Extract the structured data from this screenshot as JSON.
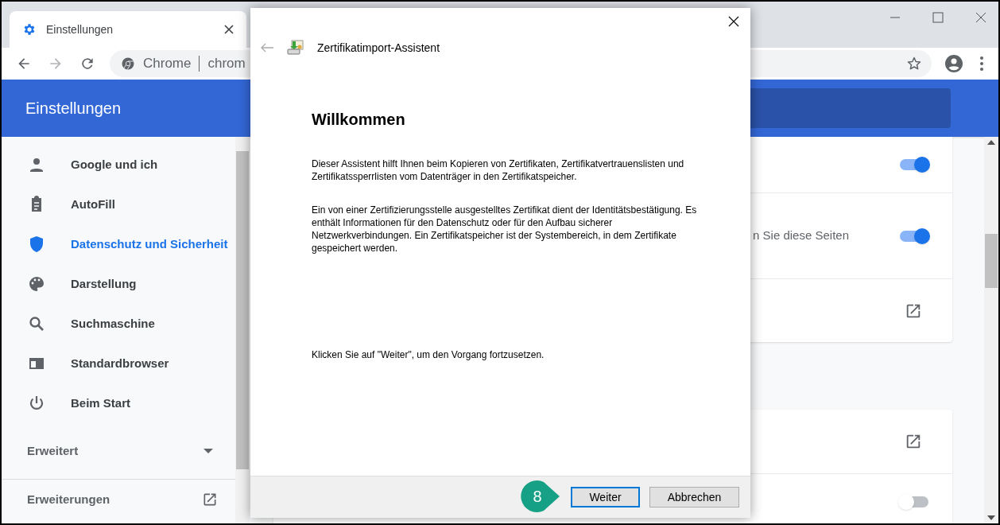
{
  "browser": {
    "tab": {
      "title": "Einstellungen"
    },
    "omnibox": {
      "site_label": "Chrome",
      "url": "chrom"
    },
    "header": {
      "title": "Einstellungen"
    },
    "sidebar": {
      "items": [
        {
          "label": "Google und ich",
          "selected": false
        },
        {
          "label": "AutoFill",
          "selected": false
        },
        {
          "label": "Datenschutz und Sicherheit",
          "selected": true
        },
        {
          "label": "Darstellung",
          "selected": false
        },
        {
          "label": "Suchmaschine",
          "selected": false
        },
        {
          "label": "Standardbrowser",
          "selected": false
        },
        {
          "label": "Beim Start",
          "selected": false
        }
      ],
      "advanced": {
        "label": "Erweitert",
        "expanded": false
      },
      "extensions": {
        "label": "Erweiterungen"
      }
    },
    "content": {
      "cards": [
        {
          "rows": [
            {
              "kind": "toggle",
              "on": true
            },
            {
              "kind": "toggle",
              "text": "n Sie diese Seiten",
              "on": true
            },
            {
              "kind": "link"
            }
          ]
        },
        {
          "rows": [
            {
              "kind": "link"
            },
            {
              "kind": "toggle",
              "on": false
            }
          ]
        }
      ]
    }
  },
  "dialog": {
    "title": "Zertifikatimport-Assistent",
    "heading": "Willkommen",
    "paragraphs": [
      "Dieser Assistent hilft Ihnen beim Kopieren von Zertifikaten, Zertifikatvertrauenslisten und Zertifikatssperrlisten vom Datenträger in den Zertifikatspeicher.",
      "Ein von einer Zertifizierungsstelle ausgestelltes Zertifikat dient der Identitätsbestätigung. Es enthält Informationen für den Datenschutz oder für den Aufbau sicherer Netzwerkverbindungen. Ein Zertifikatspeicher ist der Systembereich, in dem Zertifikate gespeichert werden."
    ],
    "instruction": "Klicken Sie auf \"Weiter\", um den Vorgang fortzusetzen.",
    "buttons": [
      {
        "label": "Weiter",
        "default": true
      },
      {
        "label": "Abbrechen",
        "default": false
      }
    ]
  },
  "callout": {
    "label": "8"
  }
}
